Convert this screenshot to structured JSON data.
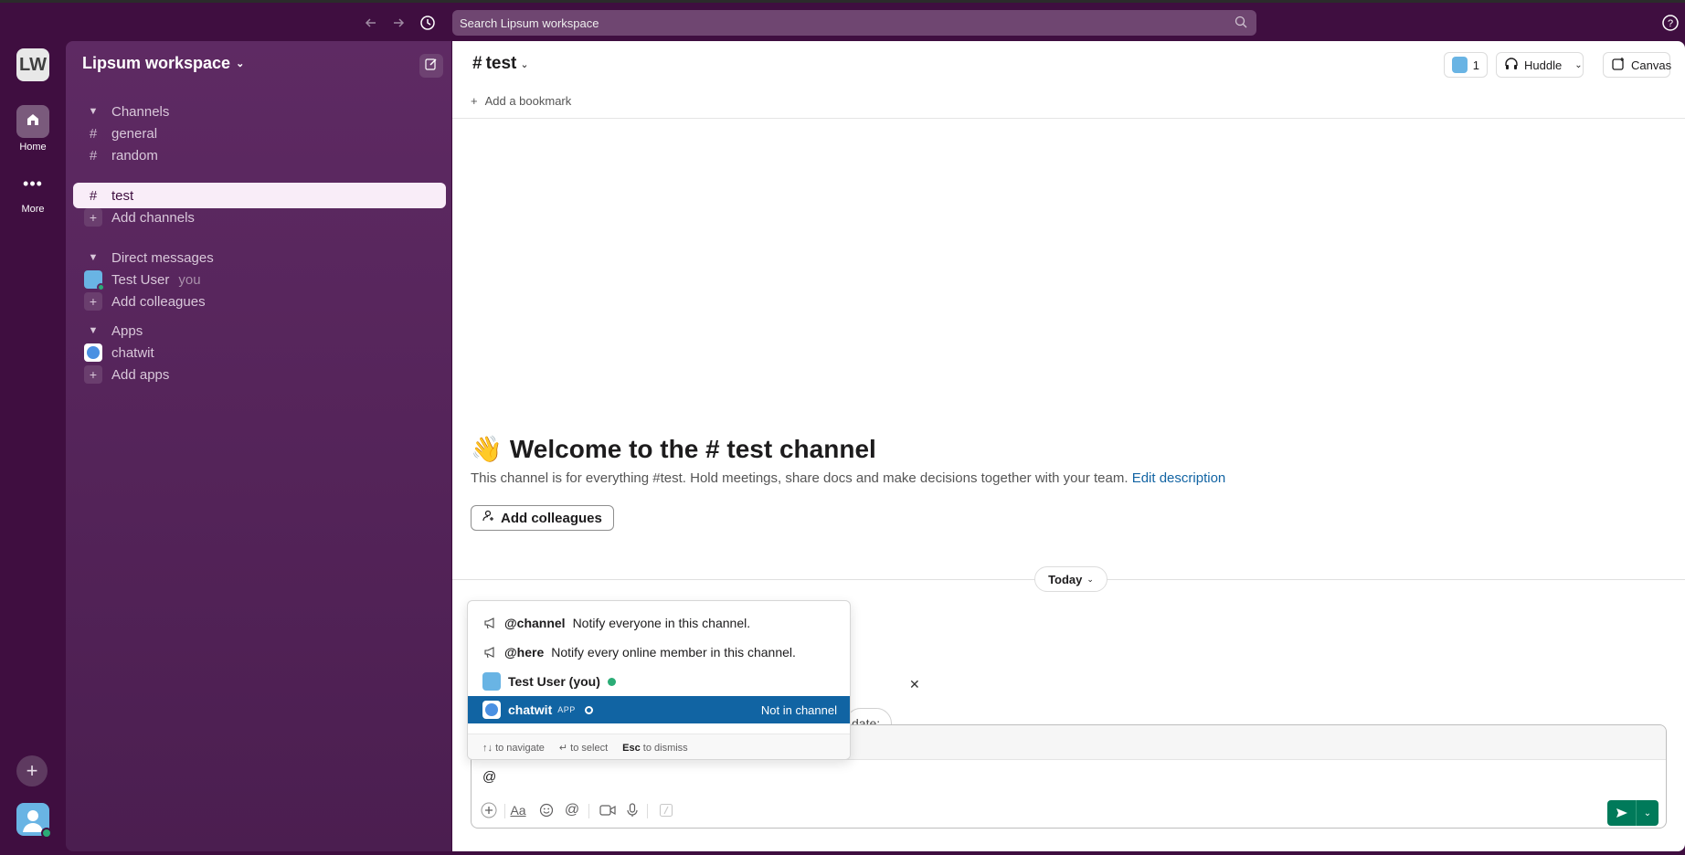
{
  "topbar": {
    "search_placeholder": "Search Lipsum workspace"
  },
  "rail": {
    "workspace_initials": "LW",
    "home_label": "Home",
    "more_label": "More"
  },
  "sidebar": {
    "workspace_name": "Lipsum workspace",
    "channels_header": "Channels",
    "channels": [
      "general",
      "random",
      "test"
    ],
    "add_channels": "Add channels",
    "dm_header": "Direct messages",
    "dm_user": "Test User",
    "dm_you": "you",
    "add_colleagues": "Add colleagues",
    "apps_header": "Apps",
    "app_name": "chatwit",
    "add_apps": "Add apps"
  },
  "channel": {
    "name": "test",
    "add_bookmark": "Add a bookmark",
    "member_count": "1",
    "huddle_label": "Huddle",
    "canvas_label": "Canvas",
    "welcome_title": "Welcome to the # test channel",
    "welcome_emoji": "👋",
    "description": "This channel is for everything #test. Hold meetings, share docs and make decisions together with your team.",
    "edit_description": "Edit description",
    "add_colleagues_btn": "Add colleagues",
    "today_label": "Today",
    "partial_chip": "date:"
  },
  "composer": {
    "value": "@"
  },
  "mention_popup": {
    "items": [
      {
        "handle": "@channel",
        "desc": "Notify everyone in this channel."
      },
      {
        "handle": "@here",
        "desc": "Notify every online member in this channel."
      },
      {
        "handle": "Test User (you)"
      },
      {
        "handle": "chatwit",
        "tag": "APP",
        "right": "Not in channel"
      }
    ],
    "footer": {
      "navigate": "to navigate",
      "select": "to select",
      "esc_key": "Esc",
      "dismiss": "to dismiss"
    }
  },
  "colors": {
    "aubergine": "#3f0e40",
    "selected_blue": "#1164a3",
    "send_green": "#007a5a",
    "online_green": "#2bac76"
  }
}
